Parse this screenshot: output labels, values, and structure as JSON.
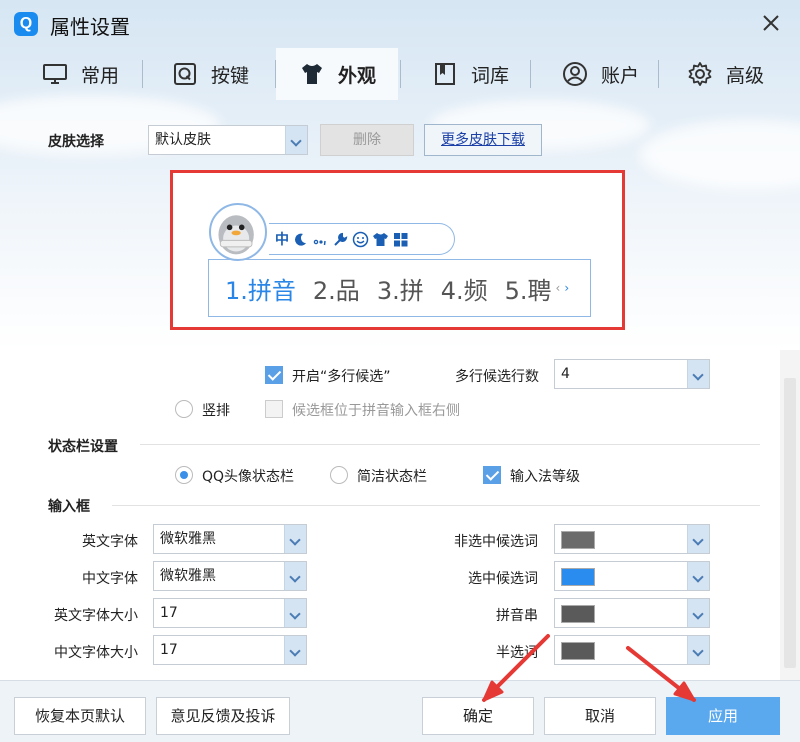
{
  "window": {
    "title": "属性设置",
    "logo_letter": "Q"
  },
  "tabs": [
    {
      "label": "常用",
      "icon": "monitor-icon"
    },
    {
      "label": "按键",
      "icon": "q-key-icon"
    },
    {
      "label": "外观",
      "icon": "tshirt-icon",
      "active": true
    },
    {
      "label": "词库",
      "icon": "book-icon"
    },
    {
      "label": "账户",
      "icon": "user-icon"
    },
    {
      "label": "高级",
      "icon": "gear-icon"
    }
  ],
  "skin": {
    "label": "皮肤选择",
    "selected": "默认皮肤",
    "delete_label": "删除",
    "more_label": "更多皮肤下载"
  },
  "preview": {
    "status_char": "中",
    "candidates": [
      "1.拼音",
      "2.品",
      "3.拼",
      "4.频",
      "5.聘"
    ],
    "prev_glyph": "‹",
    "next_glyph": "›"
  },
  "multiline": {
    "enable_label": "开启“多行候选”",
    "enable_checked": true,
    "count_label": "多行候选行数",
    "count_value": "4",
    "vertical_label": "竖排",
    "right_side_label": "候选框位于拼音输入框右侧"
  },
  "statusbar_settings": {
    "section": "状态栏设置",
    "opt_qq": "QQ头像状态栏",
    "opt_simple": "简洁状态栏",
    "opt_level": "输入法等级",
    "qq_selected": true,
    "level_checked": true
  },
  "input_box": {
    "section": "输入框",
    "fields": [
      {
        "label": "英文字体",
        "value": "微软雅黑"
      },
      {
        "label": "中文字体",
        "value": "微软雅黑"
      },
      {
        "label": "英文字体大小",
        "value": "17"
      },
      {
        "label": "中文字体大小",
        "value": "17"
      }
    ],
    "colors": [
      {
        "label": "非选中候选词",
        "color": "#6b6b6b"
      },
      {
        "label": "选中候选词",
        "color": "#2b8cf0"
      },
      {
        "label": "拼音串",
        "color": "#5a5a5a"
      },
      {
        "label": "半选词",
        "color": "#5a5a5a"
      }
    ]
  },
  "footer": {
    "restore": "恢复本页默认",
    "feedback": "意见反馈及投诉",
    "ok": "确定",
    "cancel": "取消",
    "apply": "应用"
  },
  "colors": {
    "accent": "#1a8cf0",
    "highlight_box": "#e53935",
    "primary_button": "#5aa8ee"
  }
}
